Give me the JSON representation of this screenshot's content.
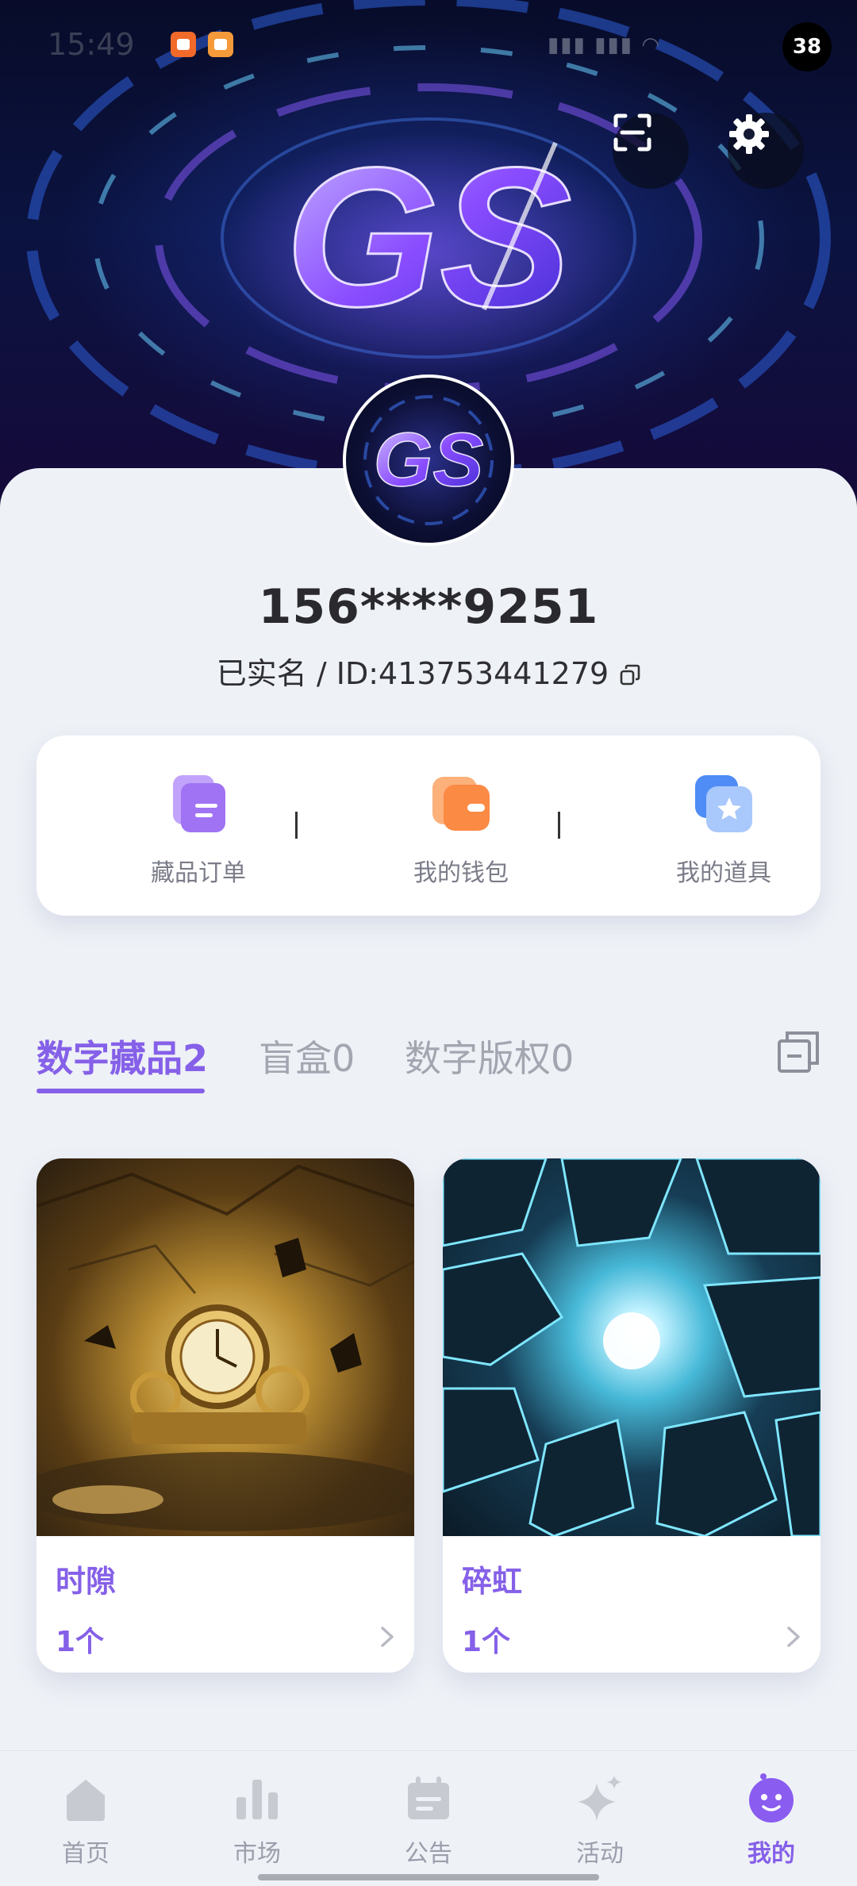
{
  "status_bar": {
    "time": "15:49",
    "battery": "38"
  },
  "hero": {
    "logo_text": "GS"
  },
  "avatar": {
    "logo_text": "GS"
  },
  "profile": {
    "phone": "156****9251",
    "verified_label": "已实名",
    "separator": " / ",
    "id_text": "ID:413753441279"
  },
  "actions": [
    {
      "label": "藏品订单",
      "icon": "collection-order-icon",
      "color": "#b48cf4"
    },
    {
      "label": "我的钱包",
      "icon": "wallet-icon",
      "color": "#fb9a5a"
    },
    {
      "label": "我的道具",
      "icon": "props-star-icon",
      "color": "#6ca3f8"
    }
  ],
  "tabs": [
    {
      "label": "数字藏品2",
      "active": true
    },
    {
      "label": "盲盒0",
      "active": false
    },
    {
      "label": "数字版权0",
      "active": false
    }
  ],
  "collections": [
    {
      "name": "时隙",
      "count": "1个"
    },
    {
      "name": "碎虹",
      "count": "1个"
    }
  ],
  "nav": [
    {
      "label": "首页",
      "icon": "home-icon"
    },
    {
      "label": "市场",
      "icon": "market-chart-icon"
    },
    {
      "label": "公告",
      "icon": "announcement-icon"
    },
    {
      "label": "活动",
      "icon": "activity-sparkle-icon"
    },
    {
      "label": "我的",
      "icon": "profile-face-icon",
      "active": true
    }
  ],
  "colors": {
    "accent": "#8560e8",
    "background": "#eef1f6"
  }
}
